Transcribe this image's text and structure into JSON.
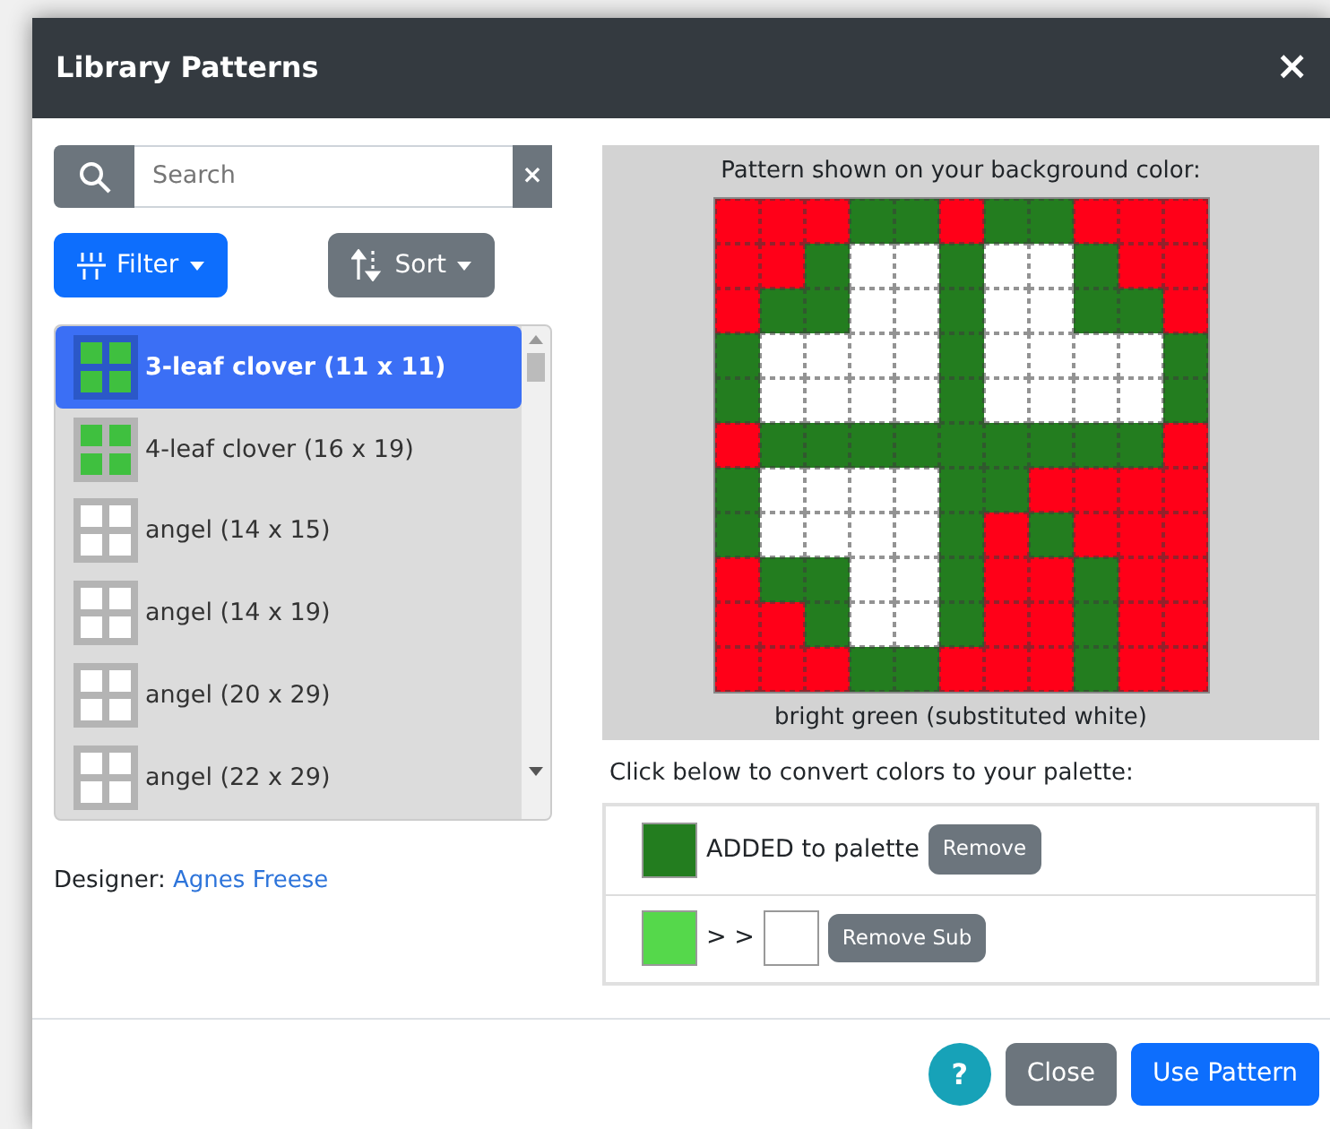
{
  "dialog": {
    "title": "Library Patterns",
    "close": "×"
  },
  "search": {
    "placeholder": "Search",
    "clear": "×"
  },
  "filter_button": "Filter",
  "sort_button": "Sort",
  "patterns": [
    {
      "label": "3-leaf clover (11 x 11)",
      "selected": true,
      "color": "#3fc03f"
    },
    {
      "label": "4-leaf clover (16 x 19)",
      "selected": false,
      "color": "#3fc03f"
    },
    {
      "label": "angel (14 x 15)",
      "selected": false,
      "color": "#ffffff"
    },
    {
      "label": "angel (14 x 19)",
      "selected": false,
      "color": "#ffffff"
    },
    {
      "label": "angel (20 x 29)",
      "selected": false,
      "color": "#ffffff"
    },
    {
      "label": "angel (22 x 29)",
      "selected": false,
      "color": "#ffffff"
    }
  ],
  "designer": {
    "label": "Designer:",
    "name": "Agnes Freese"
  },
  "preview": {
    "caption": "Pattern shown on your background color:",
    "rows": [
      {
        "cells": [
          {
            "color": "#ff0018"
          },
          {
            "color": "#ff0018"
          },
          {
            "color": "#ff0018"
          },
          {
            "color": "#237d1f"
          },
          {
            "color": "#237d1f"
          },
          {
            "color": "#ff0018"
          },
          {
            "color": "#237d1f"
          },
          {
            "color": "#237d1f"
          },
          {
            "color": "#ff0018"
          },
          {
            "color": "#ff0018"
          },
          {
            "color": "#ff0018"
          }
        ]
      },
      {
        "cells": [
          {
            "color": "#ff0018"
          },
          {
            "color": "#ff0018"
          },
          {
            "color": "#237d1f"
          },
          {
            "color": "#ffffff"
          },
          {
            "color": "#ffffff"
          },
          {
            "color": "#237d1f"
          },
          {
            "color": "#ffffff"
          },
          {
            "color": "#ffffff"
          },
          {
            "color": "#237d1f"
          },
          {
            "color": "#ff0018"
          },
          {
            "color": "#ff0018"
          }
        ]
      },
      {
        "cells": [
          {
            "color": "#ff0018"
          },
          {
            "color": "#237d1f"
          },
          {
            "color": "#237d1f"
          },
          {
            "color": "#ffffff"
          },
          {
            "color": "#ffffff"
          },
          {
            "color": "#237d1f"
          },
          {
            "color": "#ffffff"
          },
          {
            "color": "#ffffff"
          },
          {
            "color": "#237d1f"
          },
          {
            "color": "#237d1f"
          },
          {
            "color": "#ff0018"
          }
        ]
      },
      {
        "cells": [
          {
            "color": "#237d1f"
          },
          {
            "color": "#ffffff"
          },
          {
            "color": "#ffffff"
          },
          {
            "color": "#ffffff"
          },
          {
            "color": "#ffffff"
          },
          {
            "color": "#237d1f"
          },
          {
            "color": "#ffffff"
          },
          {
            "color": "#ffffff"
          },
          {
            "color": "#ffffff"
          },
          {
            "color": "#ffffff"
          },
          {
            "color": "#237d1f"
          }
        ]
      },
      {
        "cells": [
          {
            "color": "#237d1f"
          },
          {
            "color": "#ffffff"
          },
          {
            "color": "#ffffff"
          },
          {
            "color": "#ffffff"
          },
          {
            "color": "#ffffff"
          },
          {
            "color": "#237d1f"
          },
          {
            "color": "#ffffff"
          },
          {
            "color": "#ffffff"
          },
          {
            "color": "#ffffff"
          },
          {
            "color": "#ffffff"
          },
          {
            "color": "#237d1f"
          }
        ]
      },
      {
        "cells": [
          {
            "color": "#ff0018"
          },
          {
            "color": "#237d1f"
          },
          {
            "color": "#237d1f"
          },
          {
            "color": "#237d1f"
          },
          {
            "color": "#237d1f"
          },
          {
            "color": "#237d1f"
          },
          {
            "color": "#237d1f"
          },
          {
            "color": "#237d1f"
          },
          {
            "color": "#237d1f"
          },
          {
            "color": "#237d1f"
          },
          {
            "color": "#ff0018"
          }
        ]
      },
      {
        "cells": [
          {
            "color": "#237d1f"
          },
          {
            "color": "#ffffff"
          },
          {
            "color": "#ffffff"
          },
          {
            "color": "#ffffff"
          },
          {
            "color": "#ffffff"
          },
          {
            "color": "#237d1f"
          },
          {
            "color": "#237d1f"
          },
          {
            "color": "#ff0018"
          },
          {
            "color": "#ff0018"
          },
          {
            "color": "#ff0018"
          },
          {
            "color": "#ff0018"
          }
        ]
      },
      {
        "cells": [
          {
            "color": "#237d1f"
          },
          {
            "color": "#ffffff"
          },
          {
            "color": "#ffffff"
          },
          {
            "color": "#ffffff"
          },
          {
            "color": "#ffffff"
          },
          {
            "color": "#237d1f"
          },
          {
            "color": "#ff0018"
          },
          {
            "color": "#237d1f"
          },
          {
            "color": "#ff0018"
          },
          {
            "color": "#ff0018"
          },
          {
            "color": "#ff0018"
          }
        ]
      },
      {
        "cells": [
          {
            "color": "#ff0018"
          },
          {
            "color": "#237d1f"
          },
          {
            "color": "#237d1f"
          },
          {
            "color": "#ffffff"
          },
          {
            "color": "#ffffff"
          },
          {
            "color": "#237d1f"
          },
          {
            "color": "#ff0018"
          },
          {
            "color": "#ff0018"
          },
          {
            "color": "#237d1f"
          },
          {
            "color": "#ff0018"
          },
          {
            "color": "#ff0018"
          }
        ]
      },
      {
        "cells": [
          {
            "color": "#ff0018"
          },
          {
            "color": "#ff0018"
          },
          {
            "color": "#237d1f"
          },
          {
            "color": "#ffffff"
          },
          {
            "color": "#ffffff"
          },
          {
            "color": "#237d1f"
          },
          {
            "color": "#ff0018"
          },
          {
            "color": "#ff0018"
          },
          {
            "color": "#237d1f"
          },
          {
            "color": "#ff0018"
          },
          {
            "color": "#ff0018"
          }
        ]
      },
      {
        "cells": [
          {
            "color": "#ff0018"
          },
          {
            "color": "#ff0018"
          },
          {
            "color": "#ff0018"
          },
          {
            "color": "#237d1f"
          },
          {
            "color": "#237d1f"
          },
          {
            "color": "#ff0018"
          },
          {
            "color": "#ff0018"
          },
          {
            "color": "#ff0018"
          },
          {
            "color": "#237d1f"
          },
          {
            "color": "#ff0018"
          },
          {
            "color": "#ff0018"
          }
        ]
      }
    ],
    "footnote": "bright green (substituted white)"
  },
  "convert_prompt": "Click below to convert colors to your palette:",
  "conversions": [
    {
      "kind": "added",
      "color": "#237d1f",
      "text": "ADDED to palette",
      "button": "Remove"
    },
    {
      "kind": "substitution",
      "color": "#55d84b",
      "arrow": "> >",
      "substitute": {
        "color": "#ffffff"
      },
      "button": "Remove Sub"
    }
  ],
  "footer": {
    "help": "?",
    "buttons": [
      {
        "label": "Close",
        "kind": "secondary"
      },
      {
        "label": "Use Pattern",
        "kind": "primary"
      }
    ]
  }
}
